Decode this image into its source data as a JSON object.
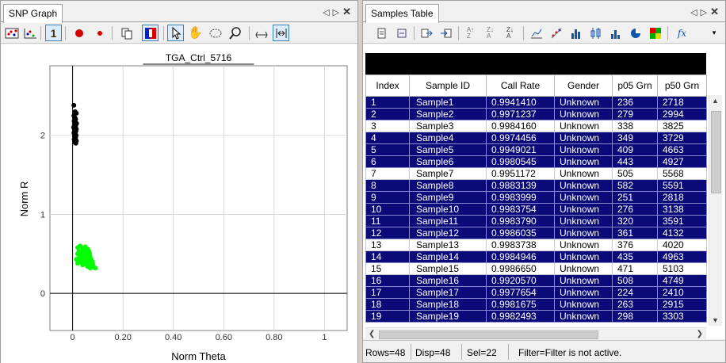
{
  "left_panel": {
    "tab_label": "SNP Graph",
    "toolbar_icons": [
      "heatmap-icon",
      "scatter-icon",
      "one-icon",
      "red-dot-large-icon",
      "red-dot-small-icon",
      "copy-icon",
      "color-icon",
      "pointer-icon",
      "hand-icon",
      "lasso-icon",
      "zoom-icon",
      "scale-icon",
      "fit-icon"
    ]
  },
  "graph": {
    "title": "TGA_Ctrl_5716",
    "xlabel": "Norm Theta",
    "ylabel": "Norm R",
    "x_ticks": [
      "0",
      "0.20",
      "0.40",
      "0.60",
      "0.80",
      "1"
    ],
    "y_ticks": [
      "0",
      "1",
      "2"
    ],
    "cluster_colors": {
      "black": "#000000",
      "green": "#00ff00"
    }
  },
  "chart_data": {
    "type": "scatter",
    "title": "TGA_Ctrl_5716",
    "xlabel": "Norm Theta",
    "ylabel": "Norm R",
    "xlim": [
      -0.09,
      1.09
    ],
    "ylim": [
      -0.47,
      2.88
    ],
    "grid": true,
    "series": [
      {
        "color": "#000000",
        "points": [
          [
            0.005,
            2.38
          ],
          [
            0.01,
            2.3
          ],
          [
            0.015,
            2.28
          ],
          [
            0.005,
            2.25
          ],
          [
            0.01,
            2.22
          ],
          [
            0.012,
            2.2
          ],
          [
            0.006,
            2.18
          ],
          [
            0.01,
            2.17
          ],
          [
            0.016,
            2.15
          ],
          [
            0.007,
            2.13
          ],
          [
            0.012,
            2.12
          ],
          [
            0.004,
            2.1
          ],
          [
            0.01,
            2.09
          ],
          [
            0.015,
            2.08
          ],
          [
            0.008,
            2.06
          ],
          [
            0.013,
            2.05
          ],
          [
            0.005,
            2.03
          ],
          [
            0.01,
            2.02
          ],
          [
            0.014,
            2.0
          ],
          [
            0.008,
            1.99
          ],
          [
            0.012,
            1.97
          ],
          [
            0.006,
            1.95
          ],
          [
            0.01,
            1.94
          ],
          [
            0.015,
            1.93
          ],
          [
            0.009,
            1.91
          ],
          [
            0.013,
            1.9
          ]
        ]
      },
      {
        "color": "#00ff00",
        "points": [
          [
            0.02,
            0.58
          ],
          [
            0.03,
            0.6
          ],
          [
            0.04,
            0.57
          ],
          [
            0.05,
            0.59
          ],
          [
            0.06,
            0.56
          ],
          [
            0.025,
            0.53
          ],
          [
            0.035,
            0.52
          ],
          [
            0.045,
            0.54
          ],
          [
            0.055,
            0.51
          ],
          [
            0.065,
            0.53
          ],
          [
            0.02,
            0.5
          ],
          [
            0.03,
            0.48
          ],
          [
            0.04,
            0.5
          ],
          [
            0.05,
            0.47
          ],
          [
            0.06,
            0.49
          ],
          [
            0.07,
            0.46
          ],
          [
            0.025,
            0.45
          ],
          [
            0.035,
            0.44
          ],
          [
            0.045,
            0.46
          ],
          [
            0.055,
            0.43
          ],
          [
            0.065,
            0.45
          ],
          [
            0.075,
            0.42
          ],
          [
            0.03,
            0.41
          ],
          [
            0.04,
            0.42
          ],
          [
            0.05,
            0.4
          ],
          [
            0.06,
            0.41
          ],
          [
            0.07,
            0.39
          ],
          [
            0.08,
            0.37
          ],
          [
            0.045,
            0.38
          ],
          [
            0.055,
            0.37
          ],
          [
            0.065,
            0.36
          ],
          [
            0.075,
            0.35
          ],
          [
            0.085,
            0.33
          ],
          [
            0.06,
            0.34
          ],
          [
            0.07,
            0.32
          ],
          [
            0.09,
            0.32
          ],
          [
            0.035,
            0.39
          ],
          [
            0.015,
            0.43
          ],
          [
            0.02,
            0.38
          ],
          [
            0.05,
            0.44
          ],
          [
            0.04,
            0.36
          ],
          [
            0.058,
            0.55
          ],
          [
            0.068,
            0.5
          ],
          [
            0.078,
            0.4
          ],
          [
            0.028,
            0.47
          ],
          [
            0.048,
            0.49
          ]
        ]
      }
    ]
  },
  "right_panel": {
    "tab_label": "Samples Table",
    "toolbar_icons": [
      "edit-icon",
      "filter-icon",
      "export-icon",
      "import-icon",
      "sort-asc-icon",
      "sort-desc-icon",
      "sort-az-icon",
      "line-chart-icon",
      "scatter-plot-icon",
      "histogram-icon",
      "boxplot-icon",
      "bar-chart-icon",
      "pie-chart-icon",
      "heatmap-icon",
      "formula-icon",
      "more-icon"
    ]
  },
  "table": {
    "columns": [
      "Index",
      "Sample ID",
      "Call Rate",
      "Gender",
      "p05 Grn",
      "p50 Grn"
    ],
    "rows": [
      {
        "index": "1",
        "id": "Sample1",
        "call_rate": "0.9941410",
        "gender": "Unknown",
        "p05": "236",
        "p50": "2718",
        "selected": true
      },
      {
        "index": "2",
        "id": "Sample2",
        "call_rate": "0.9971237",
        "gender": "Unknown",
        "p05": "279",
        "p50": "2994",
        "selected": true
      },
      {
        "index": "3",
        "id": "Sample3",
        "call_rate": "0.9984160",
        "gender": "Unknown",
        "p05": "338",
        "p50": "3825",
        "selected": false
      },
      {
        "index": "4",
        "id": "Sample4",
        "call_rate": "0.9974456",
        "gender": "Unknown",
        "p05": "349",
        "p50": "3729",
        "selected": true
      },
      {
        "index": "5",
        "id": "Sample5",
        "call_rate": "0.9949021",
        "gender": "Unknown",
        "p05": "409",
        "p50": "4663",
        "selected": true
      },
      {
        "index": "6",
        "id": "Sample6",
        "call_rate": "0.9980545",
        "gender": "Unknown",
        "p05": "443",
        "p50": "4927",
        "selected": true
      },
      {
        "index": "7",
        "id": "Sample7",
        "call_rate": "0.9951172",
        "gender": "Unknown",
        "p05": "505",
        "p50": "5568",
        "selected": false
      },
      {
        "index": "8",
        "id": "Sample8",
        "call_rate": "0.9883139",
        "gender": "Unknown",
        "p05": "582",
        "p50": "5591",
        "selected": true
      },
      {
        "index": "9",
        "id": "Sample9",
        "call_rate": "0.9983999",
        "gender": "Unknown",
        "p05": "251",
        "p50": "2818",
        "selected": true
      },
      {
        "index": "10",
        "id": "Sample10",
        "call_rate": "0.9983754",
        "gender": "Unknown",
        "p05": "276",
        "p50": "3138",
        "selected": true
      },
      {
        "index": "11",
        "id": "Sample11",
        "call_rate": "0.9983790",
        "gender": "Unknown",
        "p05": "320",
        "p50": "3591",
        "selected": true
      },
      {
        "index": "12",
        "id": "Sample12",
        "call_rate": "0.9986035",
        "gender": "Unknown",
        "p05": "361",
        "p50": "4132",
        "selected": true
      },
      {
        "index": "13",
        "id": "Sample13",
        "call_rate": "0.9983738",
        "gender": "Unknown",
        "p05": "376",
        "p50": "4020",
        "selected": false
      },
      {
        "index": "14",
        "id": "Sample14",
        "call_rate": "0.9984946",
        "gender": "Unknown",
        "p05": "435",
        "p50": "4963",
        "selected": true
      },
      {
        "index": "15",
        "id": "Sample15",
        "call_rate": "0.9986650",
        "gender": "Unknown",
        "p05": "471",
        "p50": "5103",
        "selected": false
      },
      {
        "index": "16",
        "id": "Sample16",
        "call_rate": "0.9920570",
        "gender": "Unknown",
        "p05": "508",
        "p50": "4749",
        "selected": true
      },
      {
        "index": "17",
        "id": "Sample17",
        "call_rate": "0.9977654",
        "gender": "Unknown",
        "p05": "224",
        "p50": "2410",
        "selected": true
      },
      {
        "index": "18",
        "id": "Sample18",
        "call_rate": "0.9981675",
        "gender": "Unknown",
        "p05": "263",
        "p50": "2915",
        "selected": true
      },
      {
        "index": "19",
        "id": "Sample19",
        "call_rate": "0.9982493",
        "gender": "Unknown",
        "p05": "298",
        "p50": "3303",
        "selected": true
      }
    ],
    "selected_color": "#0a0a78"
  },
  "status": {
    "rows": "Rows=48",
    "disp": "Disp=48",
    "sel": "Sel=22",
    "filter": "Filter=Filter is not active."
  }
}
